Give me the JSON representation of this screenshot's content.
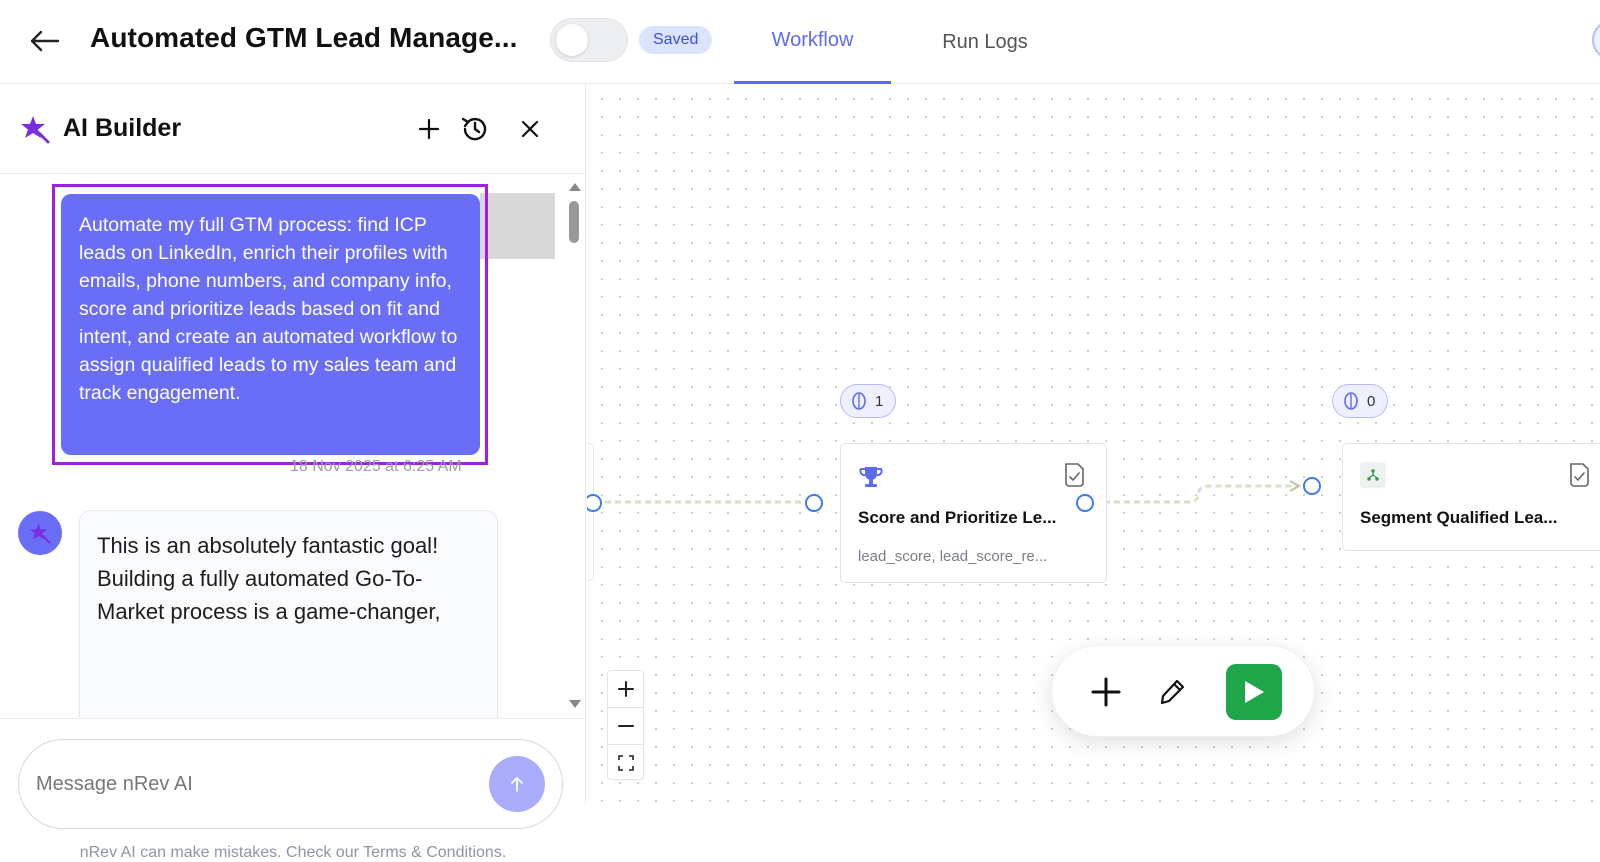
{
  "header": {
    "title": "Automated GTM Lead Manage...",
    "status_badge": "Saved",
    "tabs": [
      {
        "label": "Workflow",
        "active": true
      },
      {
        "label": "Run Logs",
        "active": false
      }
    ]
  },
  "ai_builder": {
    "title": "AI Builder",
    "user_message": "Automate my full GTM process: find ICP leads on LinkedIn, enrich their profiles with emails, phone numbers, and company info, score and prioritize leads based on fit and intent, and create an automated workflow to assign qualified leads to my sales team and track engagement.",
    "user_message_time": "18 Nov 2025 at 6:25 AM",
    "assistant_message": "This is an absolutely fantastic goal! Building a fully automated Go-To-Market process is a game-changer,",
    "input_placeholder": "Message nRev AI",
    "disclaimer": "nRev AI can make mistakes. Check our Terms & Conditions."
  },
  "canvas": {
    "nodes": [
      {
        "title": "Score and Prioritize Le...",
        "subtitle": "lead_score, lead_score_re...",
        "icon": "trophy-icon",
        "count": "1"
      },
      {
        "title": "Segment Qualified Lea...",
        "subtitle": "",
        "icon": "split-icon",
        "count": "0"
      }
    ]
  },
  "colors": {
    "accent": "#5e6bf0",
    "user_bubble": "#6a6ef7",
    "highlight": "#a21ee0",
    "run": "#1fa64a",
    "port": "#3d7bf5"
  }
}
